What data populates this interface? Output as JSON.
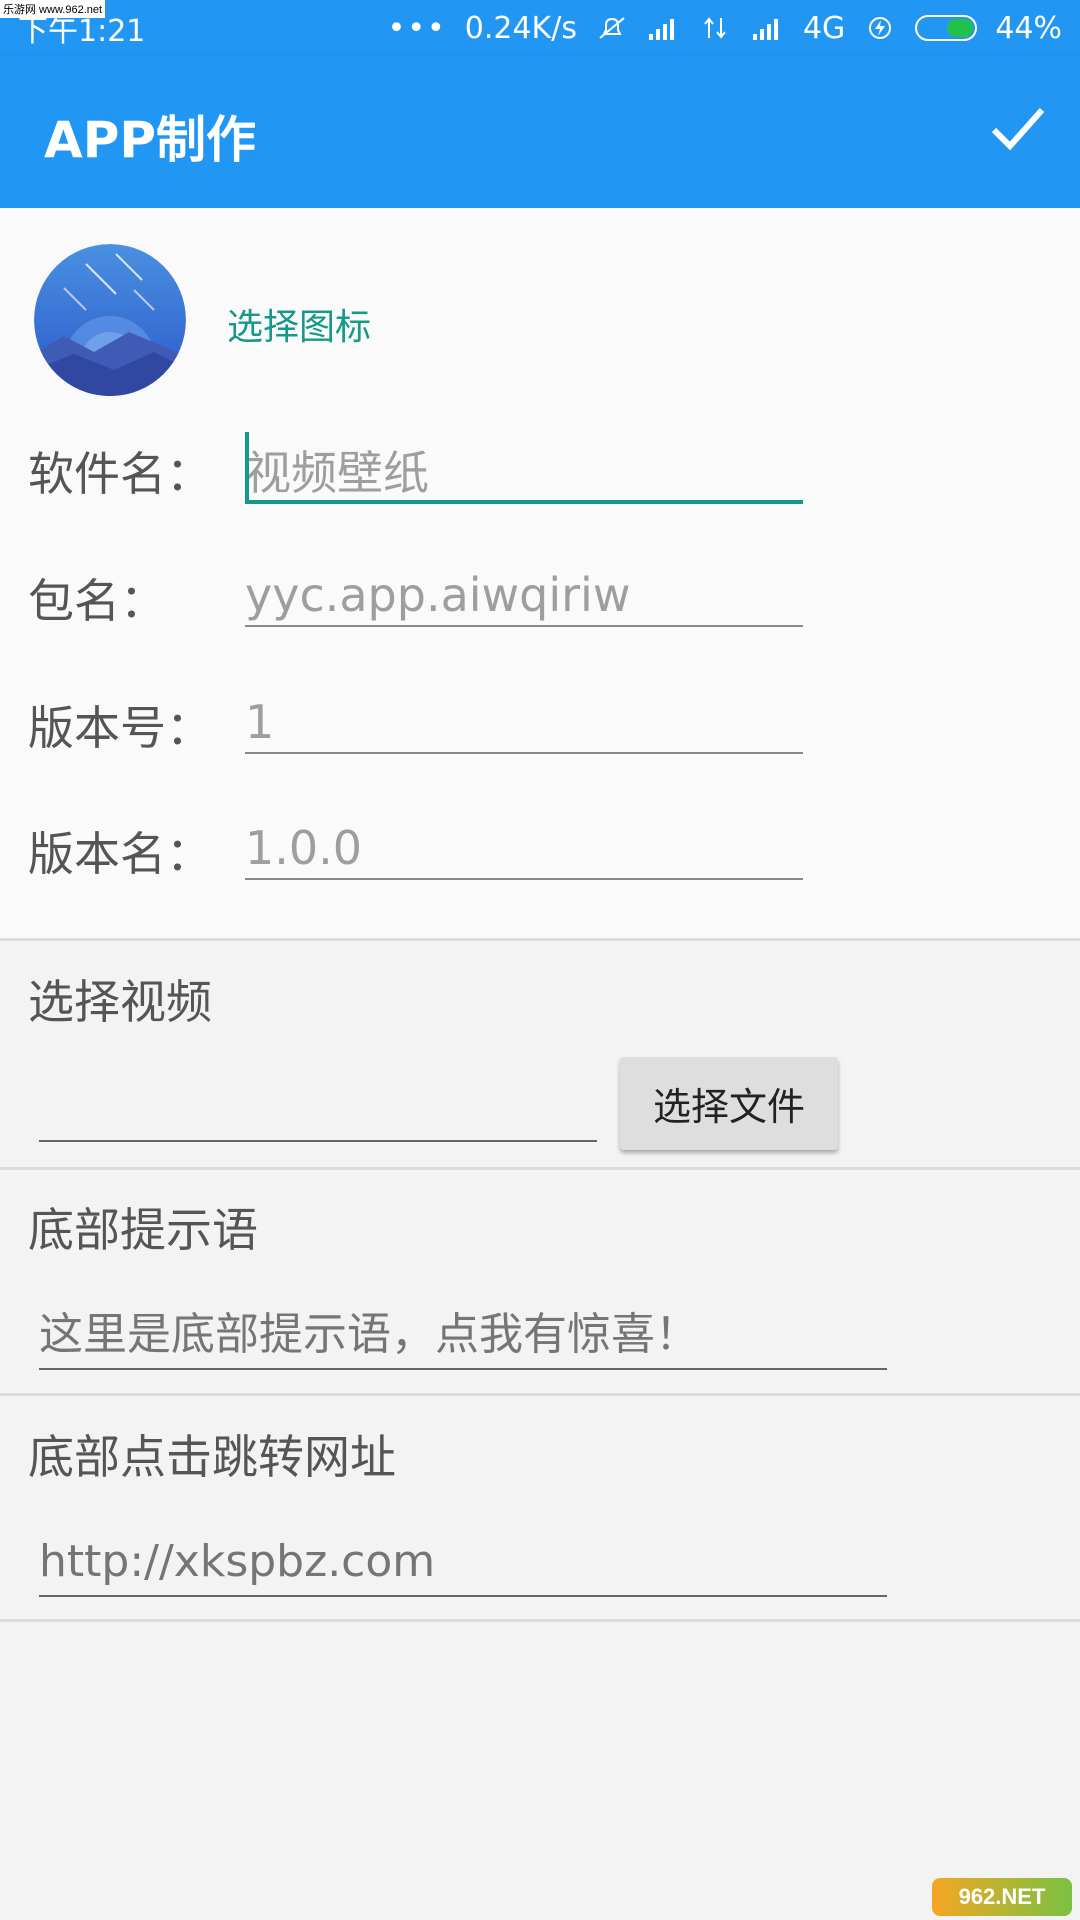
{
  "status_bar": {
    "time": "下午1:21",
    "dots": "•••",
    "speed": "0.24K/s",
    "network": "4G",
    "battery": "44%",
    "watermark": "乐游网 www.962.net"
  },
  "app_bar": {
    "title": "APP制作"
  },
  "icon_section": {
    "pick_label": "选择图标"
  },
  "fields": [
    {
      "label": "软件名：",
      "value": "视频壁纸"
    },
    {
      "label": "包名：",
      "value": "yyc.app.aiwqiriw"
    },
    {
      "label": "版本号：",
      "value": "1"
    },
    {
      "label": "版本名：",
      "value": "1.0.0"
    }
  ],
  "video_section": {
    "title": "选择视频",
    "value": "",
    "button_label": "选择文件"
  },
  "footer_tip_section": {
    "title": "底部提示语",
    "placeholder": "这里是底部提示语，点我有惊喜！"
  },
  "footer_url_section": {
    "title": "底部点击跳转网址",
    "placeholder": "http://xkspbz.com"
  },
  "bottom_watermark": "962.NET"
}
